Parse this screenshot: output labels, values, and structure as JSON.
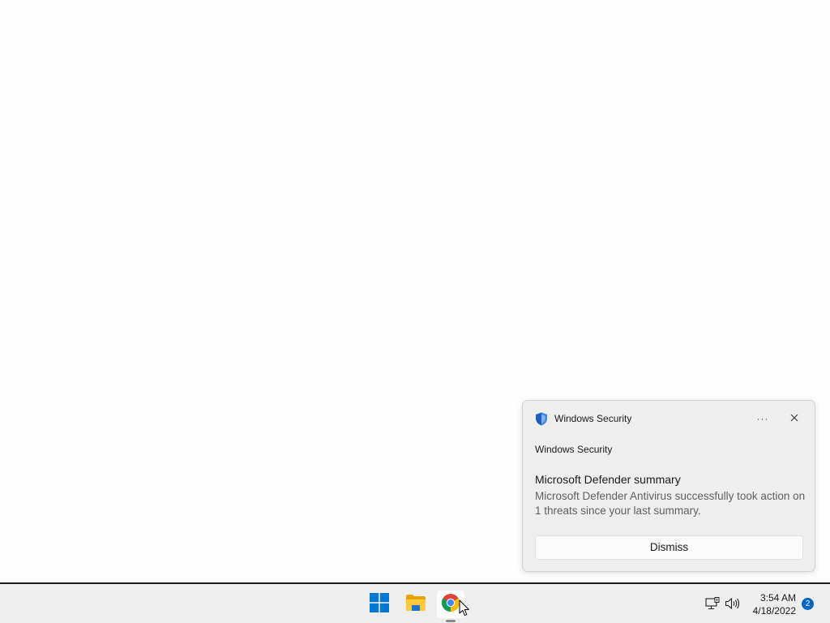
{
  "toast": {
    "app_name": "Windows Security",
    "source": "Windows Security",
    "title": "Microsoft Defender summary",
    "body": "Microsoft Defender Antivirus successfully took action on 1 threats since your last summary.",
    "dismiss_label": "Dismiss",
    "more_label": "···",
    "app_icon": "shield-icon",
    "close_icon": "close-icon"
  },
  "taskbar": {
    "items": [
      {
        "name": "Start",
        "icon": "windows-logo-icon"
      },
      {
        "name": "File Explorer",
        "icon": "folder-icon"
      },
      {
        "name": "Google Chrome",
        "icon": "chrome-icon",
        "active": true
      }
    ],
    "tray": {
      "network_icon": "network-icon",
      "volume_icon": "volume-icon",
      "time": "3:54 AM",
      "date": "4/18/2022",
      "notification_count": "2"
    }
  },
  "colors": {
    "accent": "#0067c0",
    "windows_logo": "#0078d4",
    "folder": "#f0b400",
    "toast_background": "#eeeeee",
    "taskbar_background": "#eeeeee"
  }
}
